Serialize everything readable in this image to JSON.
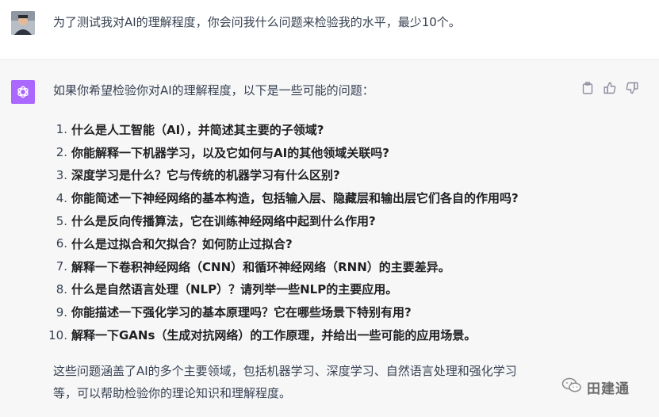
{
  "user": {
    "message": "为了测试我对AI的理解程度，你会问我什么问题来检验我的水平，最少10个。"
  },
  "assistant": {
    "intro": "如果你希望检验你对AI的理解程度，以下是一些可能的问题：",
    "questions": [
      {
        "num": "1.",
        "text": "什么是人工智能（AI），并简述其主要的子领域?"
      },
      {
        "num": "2.",
        "text": "你能解释一下机器学习，以及它如何与AI的其他领域关联吗?"
      },
      {
        "num": "3.",
        "text": "深度学习是什么？它与传统的机器学习有什么区别?"
      },
      {
        "num": "4.",
        "text": "你能简述一下神经网络的基本构造，包括输入层、隐藏层和输出层它们各自的作用吗?"
      },
      {
        "num": "5.",
        "text": "什么是反向传播算法，它在训练神经网络中起到什么作用?"
      },
      {
        "num": "6.",
        "text": "什么是过拟合和欠拟合？如何防止过拟合?"
      },
      {
        "num": "7.",
        "text": "解释一下卷积神经网络（CNN）和循环神经网络（RNN）的主要差异。"
      },
      {
        "num": "8.",
        "text": "什么是自然语言处理（NLP）？请列举一些NLP的主要应用。"
      },
      {
        "num": "9.",
        "text": "你能描述一下强化学习的基本原理吗？它在哪些场景下特别有用?"
      },
      {
        "num": "10.",
        "text": "解释一下GANs（生成对抗网络）的工作原理，并给出一些可能的应用场景。"
      }
    ],
    "summary_line1": "这些问题涵盖了AI的多个主要领域，包括机器学习、深度学习、自然语言处理和强化学习",
    "summary_line2": "等，可以帮助检验你的理论知识和理解程度。"
  },
  "icons": {
    "copy": "clipboard-icon",
    "like": "thumbs-up-icon",
    "dislike": "thumbs-down-icon",
    "assistant_logo": "openai-logo-icon",
    "watermark": "wechat-icon"
  },
  "watermark": {
    "text": "田建通"
  },
  "colors": {
    "assistant_bg": "#f7f7f8",
    "assistant_avatar": "#ab68ff",
    "text": "#374151"
  }
}
